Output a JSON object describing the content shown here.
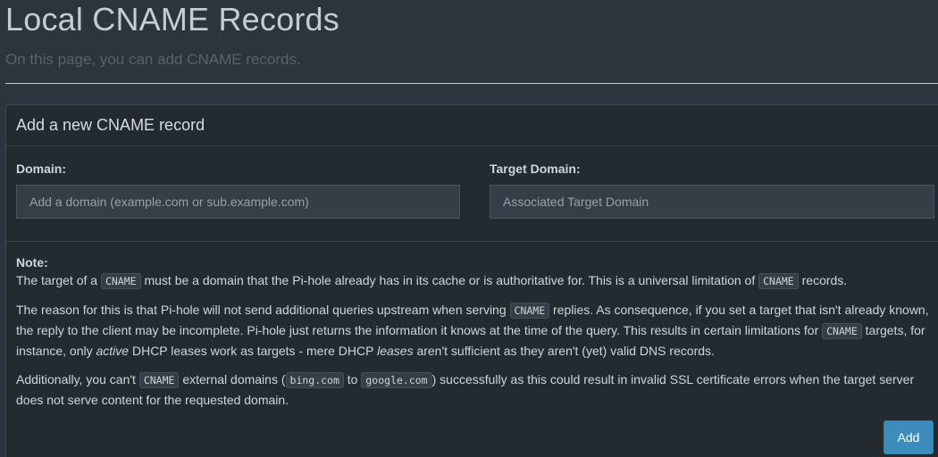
{
  "header": {
    "title": "Local CNAME Records",
    "subtitle": "On this page, you can add CNAME records."
  },
  "box": {
    "title": "Add a new CNAME record",
    "domain_label": "Domain:",
    "domain_placeholder": "Add a domain (example.com or sub.example.com)",
    "domain_value": "",
    "target_label": "Target Domain:",
    "target_placeholder": "Associated Target Domain",
    "target_value": "",
    "add_label": "Add"
  },
  "note": {
    "label": "Note:",
    "p1": {
      "t1": "The target of a ",
      "code1": "CNAME",
      "t2": " must be a domain that the Pi-hole already has in its cache or is authoritative for. This is a universal limitation of ",
      "code2": "CNAME",
      "t3": " records."
    },
    "p2": {
      "t1": "The reason for this is that Pi-hole will not send additional queries upstream when serving ",
      "code1": "CNAME",
      "t2": " replies. As consequence, if you set a target that isn't already known, the reply to the client may be incomplete. Pi-hole just returns the information it knows at the time of the query. This results in certain limitations for ",
      "code2": "CNAME",
      "t3": " targets, for instance, only ",
      "em1": "active",
      "t4": " DHCP leases work as targets - mere DHCP ",
      "em2": "leases",
      "t5": " aren't sufficient as they aren't (yet) valid DNS records."
    },
    "p3": {
      "t1": "Additionally, you can't ",
      "code1": "CNAME",
      "t2": " external domains (",
      "code2": "bing.com",
      "t3": " to ",
      "code3": "google.com",
      "t4": ") successfully as this could result in invalid SSL certificate errors when the target server does not serve content for the requested domain."
    }
  },
  "colors": {
    "background": "#2c353d",
    "box": "#232b31",
    "accent": "#3c8dbc"
  }
}
